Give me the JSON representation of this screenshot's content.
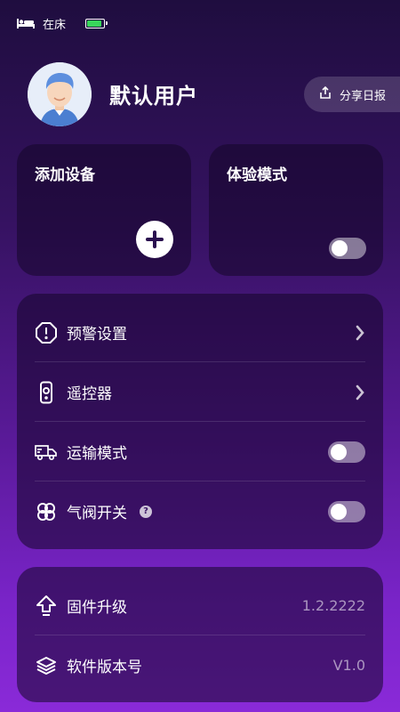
{
  "status_bar": {
    "bed_status": "在床",
    "battery_level": 0.9
  },
  "profile": {
    "username": "默认用户",
    "share_label": "分享日报"
  },
  "cards": {
    "add_device": {
      "title": "添加设备"
    },
    "experience_mode": {
      "title": "体验模式",
      "enabled": false
    }
  },
  "settings": {
    "items": [
      {
        "label": "预警设置",
        "icon": "alert-icon",
        "control": "chevron"
      },
      {
        "label": "遥控器",
        "icon": "remote-icon",
        "control": "chevron"
      },
      {
        "label": "运输模式",
        "icon": "truck-icon",
        "control": "toggle",
        "enabled": false
      },
      {
        "label": "气阀开关",
        "icon": "valve-icon",
        "control": "toggle",
        "enabled": false,
        "help": "?"
      }
    ]
  },
  "info": {
    "items": [
      {
        "label": "固件升级",
        "icon": "upgrade-icon",
        "value": "1.2.2222"
      },
      {
        "label": "软件版本号",
        "icon": "layers-icon",
        "value": "V1.0"
      }
    ]
  },
  "colors": {
    "battery": "#38d65b",
    "accent": "#8a2ad8"
  }
}
